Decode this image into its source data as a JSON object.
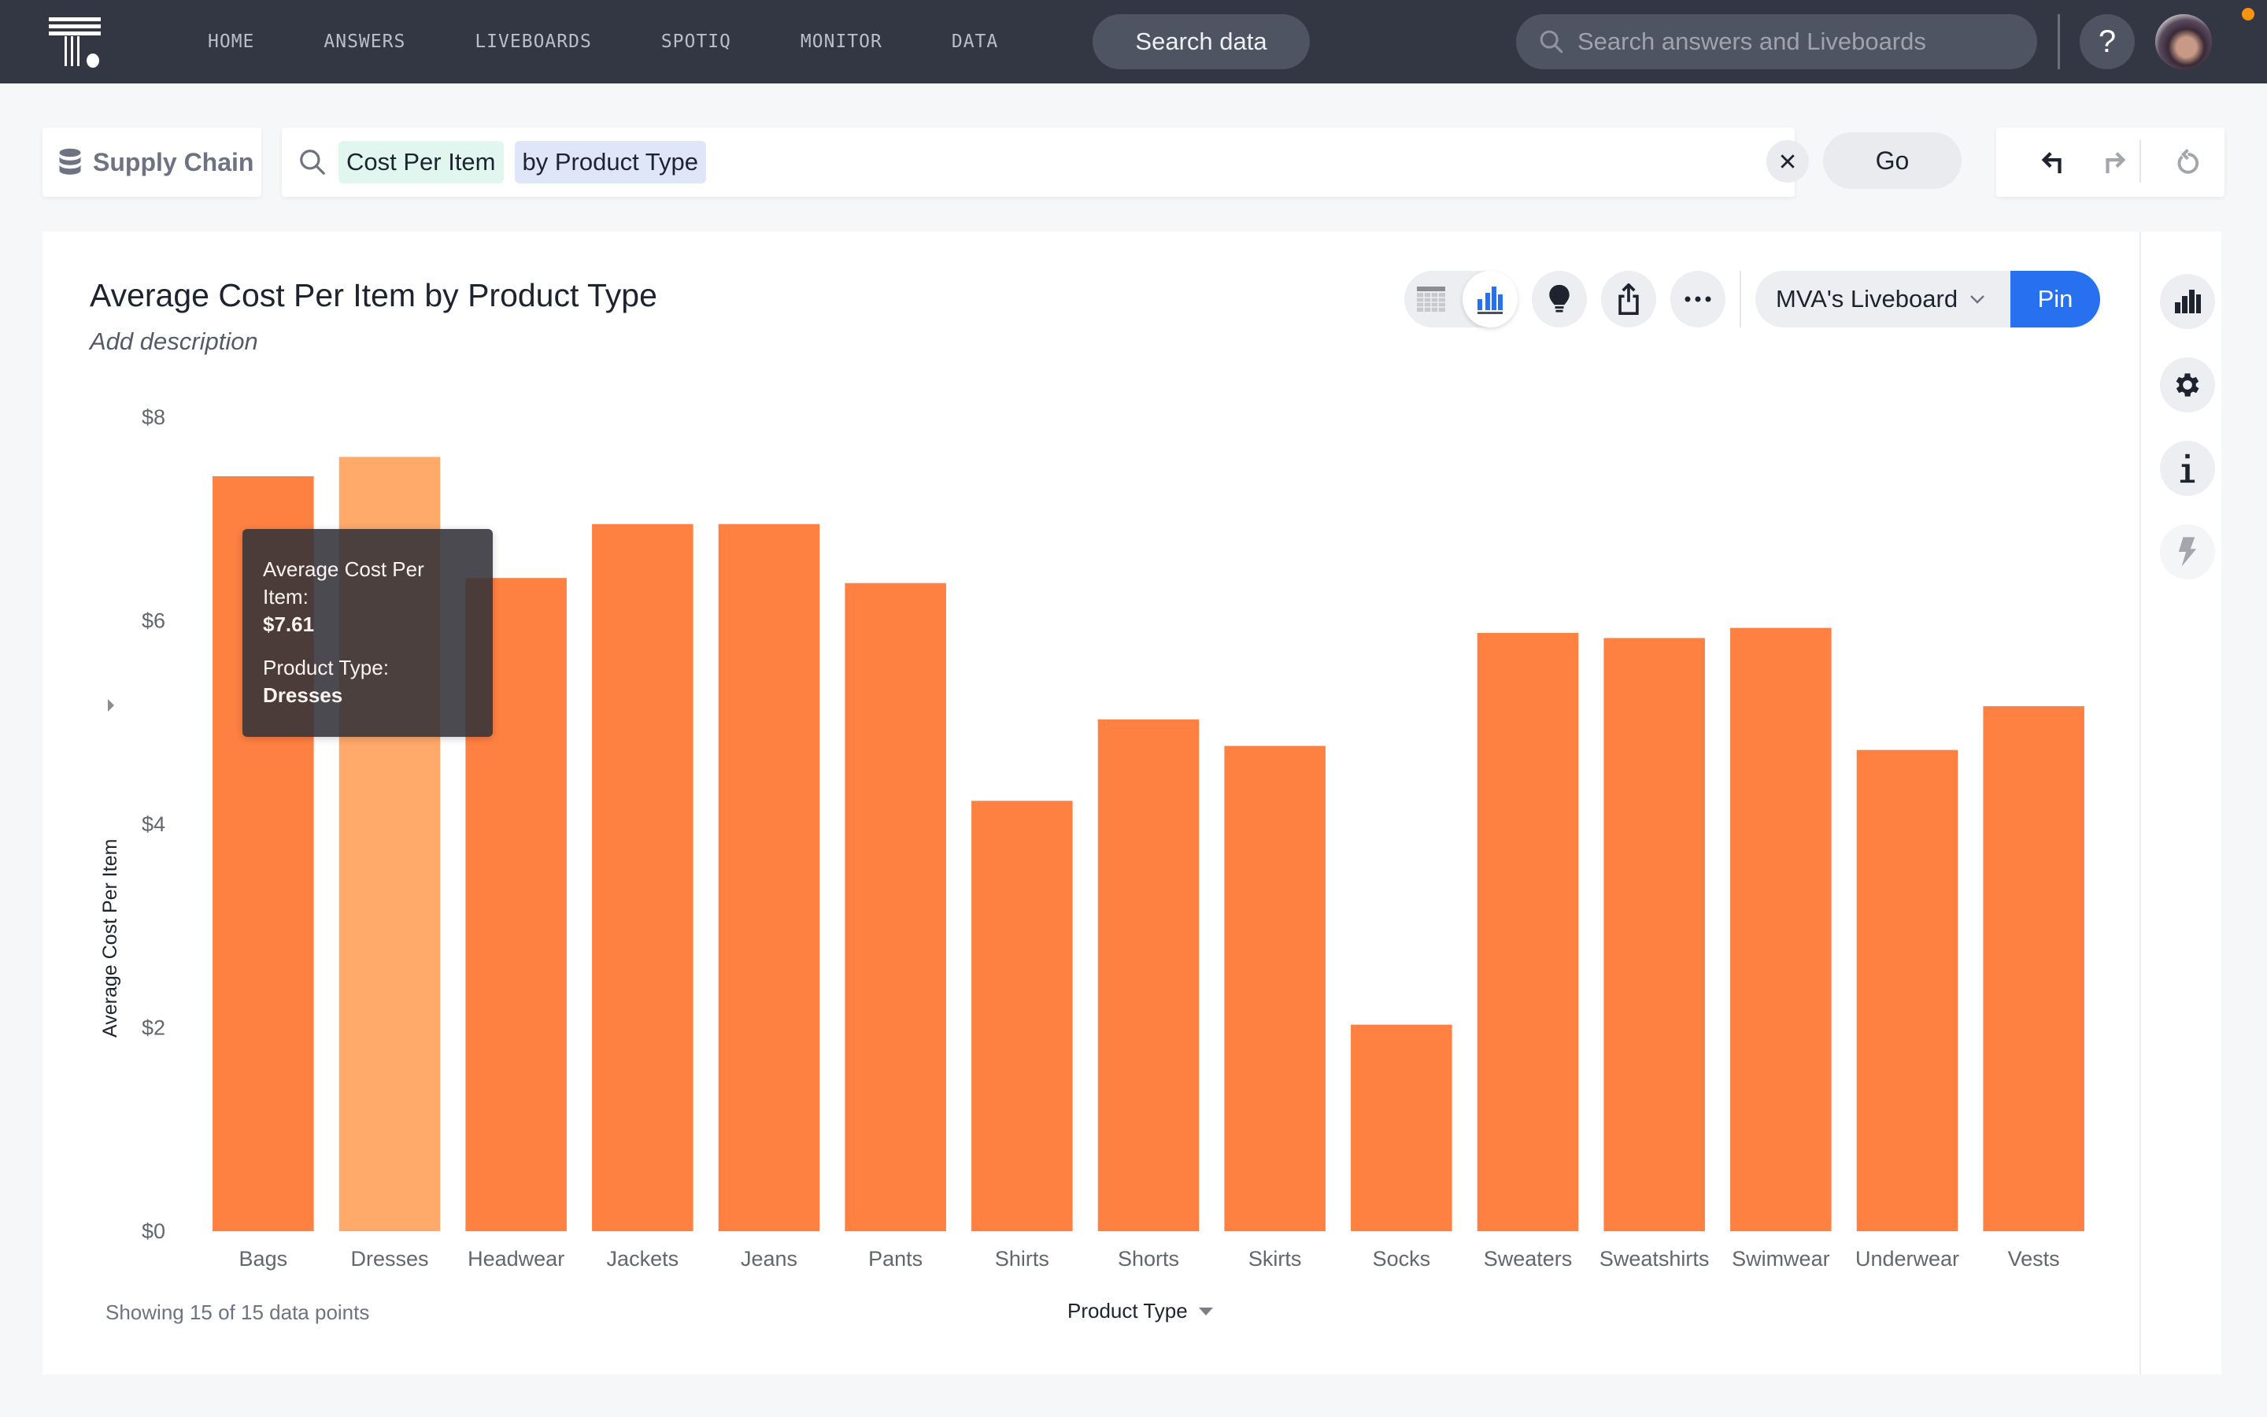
{
  "nav": {
    "links": [
      "HOME",
      "ANSWERS",
      "LIVEBOARDS",
      "SPOTIQ",
      "MONITOR",
      "DATA"
    ],
    "search_data_label": "Search data",
    "global_search_placeholder": "Search answers and Liveboards",
    "help_label": "?"
  },
  "search": {
    "source_label": "Supply Chain",
    "tokens": [
      {
        "text": "Cost Per Item",
        "kind": "measure"
      },
      {
        "text": "by Product Type",
        "kind": "attribute"
      }
    ],
    "go_label": "Go"
  },
  "answer": {
    "title": "Average Cost Per Item by Product Type",
    "description_placeholder": "Add description",
    "liveboard_select": "MVA's Liveboard",
    "pin_label": "Pin",
    "footer_count": "Showing 15 of 15 data points",
    "x_axis_selector": "Product Type"
  },
  "tooltip": {
    "measure_label": "Average Cost Per Item:",
    "measure_value": "$7.61",
    "attr_label": "Product Type:",
    "attr_value": "Dresses"
  },
  "colors": {
    "bar": "#ff8142",
    "bar_highlight": "#ffa96b",
    "accent": "#2770ef",
    "nav_bg": "#323743"
  },
  "chart_data": {
    "type": "bar",
    "title": "Average Cost Per Item by Product Type",
    "xlabel": "Product Type",
    "ylabel": "Average Cost Per Item",
    "categories": [
      "Bags",
      "Dresses",
      "Headwear",
      "Jackets",
      "Jeans",
      "Pants",
      "Shirts",
      "Shorts",
      "Skirts",
      "Socks",
      "Sweaters",
      "Sweatshirts",
      "Swimwear",
      "Underwear",
      "Vests"
    ],
    "values": [
      7.42,
      7.61,
      6.42,
      6.95,
      6.95,
      6.37,
      4.23,
      5.03,
      4.77,
      2.03,
      5.88,
      5.83,
      5.93,
      4.73,
      5.16
    ],
    "highlighted": "Dresses",
    "ylim": [
      0,
      8
    ],
    "yticks": [
      0,
      2,
      4,
      6,
      8
    ],
    "ytick_labels": [
      "$0",
      "$2",
      "$4",
      "$6",
      "$8"
    ],
    "grid": false,
    "legend": "none"
  }
}
